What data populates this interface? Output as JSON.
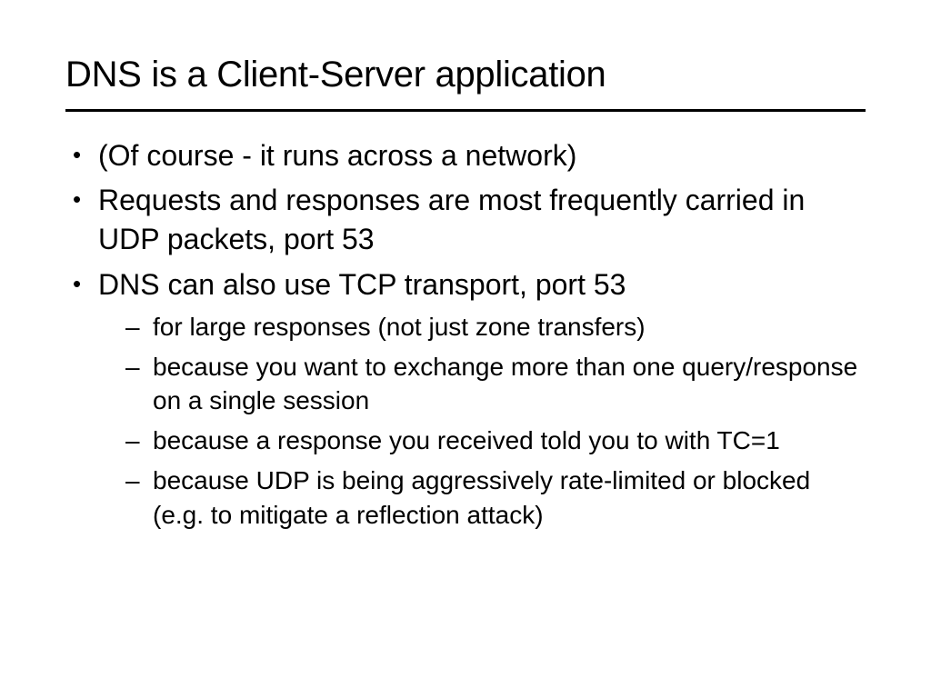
{
  "slide": {
    "title": "DNS is a Client-Server application",
    "bullets": [
      {
        "text": "(Of course - it runs across a network)"
      },
      {
        "text": "Requests and responses are most frequently carried in UDP packets, port 53"
      },
      {
        "text": "DNS can also use TCP transport, port 53",
        "sub": [
          "for large responses (not just zone transfers)",
          "because you want to exchange more than one query/response on a single session",
          "because a response you received told you to with TC=1",
          "because UDP is being aggressively rate-limited or blocked (e.g. to mitigate a reflection attack)"
        ]
      }
    ]
  }
}
